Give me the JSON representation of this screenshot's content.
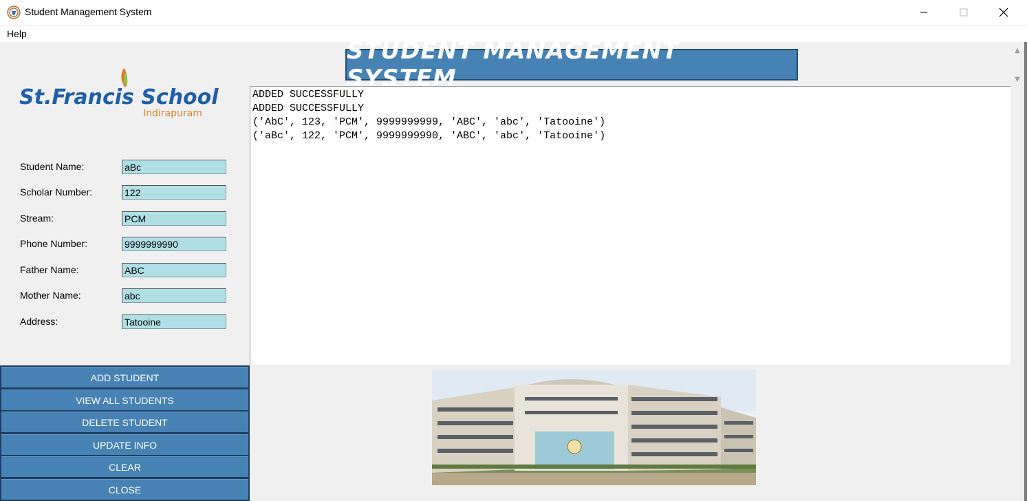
{
  "window": {
    "title": "Student Management System",
    "icon": "school-crest-icon"
  },
  "menu": {
    "help": "Help"
  },
  "logo": {
    "name": "St.Francis School",
    "subtitle": "Indirapuram"
  },
  "heading": "STUDENT MANAGEMENT SYSTEM",
  "form": [
    {
      "label": "Student Name:",
      "value": "aBc"
    },
    {
      "label": "Scholar Number:",
      "value": "122"
    },
    {
      "label": "Stream:",
      "value": "PCM"
    },
    {
      "label": "Phone Number:",
      "value": "9999999990"
    },
    {
      "label": "Father Name:",
      "value": "ABC"
    },
    {
      "label": "Mother Name:",
      "value": "abc"
    },
    {
      "label": "Address:",
      "value": "Tatooine"
    }
  ],
  "output_lines": [
    "ADDED SUCCESSFULLY",
    "ADDED SUCCESSFULLY",
    "('AbC', 123, 'PCM', 9999999999, 'ABC', 'abc', 'Tatooine')",
    "('aBc', 122, 'PCM', 9999999990, 'ABC', 'abc', 'Tatooine')"
  ],
  "buttons": {
    "add": "ADD STUDENT",
    "view": "VIEW ALL STUDENTS",
    "delete": "DELETE STUDENT",
    "update": "UPDATE INFO",
    "clear": "CLEAR",
    "close": "CLOSE"
  },
  "colors": {
    "accent": "#4682b4",
    "input_bg": "#b0e0e6",
    "logo_blue": "#1f5fa8",
    "logo_orange": "#d9822b"
  }
}
